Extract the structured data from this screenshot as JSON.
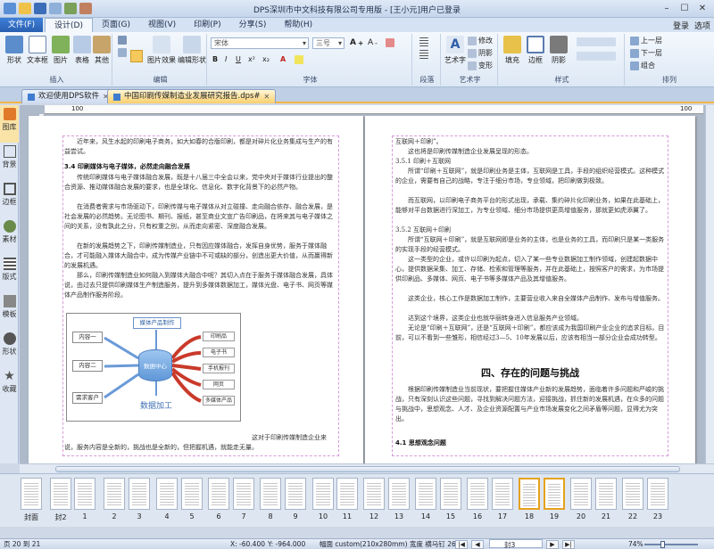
{
  "window": {
    "title": "DPS深圳市中文科技有限公司专用版 - [王小元]用户已登录"
  },
  "menu": {
    "file": "文件(F)",
    "tabs": [
      "设计(D)",
      "页面(G)",
      "视图(V)",
      "印刷(P)",
      "分享(S)",
      "帮助(H)"
    ],
    "right": [
      "登录",
      "选项"
    ]
  },
  "ribbon": {
    "insert": {
      "label": "插入",
      "shape": "形状",
      "textbox": "文本框",
      "image": "图片",
      "table": "表格",
      "other": "其他"
    },
    "edit": {
      "label": "编辑",
      "image_effect": "图片效果",
      "edit_shape": "编辑形状"
    },
    "font": {
      "label": "字体",
      "font_name": "宋体",
      "font_size": "三号"
    },
    "para": {
      "label": "段落"
    },
    "art": {
      "label": "艺术字",
      "arttext": "艺术字",
      "modify": "修改",
      "shadow": "阴影",
      "transform": "变形"
    },
    "style": {
      "label": "样式",
      "fill": "填充",
      "border": "边框",
      "shadow": "阴影"
    },
    "layout": {
      "label": "排列",
      "up": "上一层",
      "down": "下一层",
      "group": "组合"
    }
  },
  "doctabs": [
    "欢迎使用DPS软件",
    "中国印刷传媒制造业发展研究报告.dps#"
  ],
  "sidebar": [
    "图库",
    "背景",
    "边框",
    "素材",
    "版式",
    "模板",
    "形状",
    "收藏"
  ],
  "ruler": {
    "left_mark": "100",
    "right_mark": "100"
  },
  "left_page": {
    "p1": "近年来，风生水起的印刷电子商务，如大如春的合版印刷，都是对碎片化业务集成与生产的有益尝试。",
    "h1": "3.4 印刷媒体与电子媒体，必然走向融合发展",
    "p2": "传统印刷媒体与电子媒体融合发展，既是十八届三中全会以来，党中央对于媒体行业提出的整合资源、推动媒体融合发展的要求，也是全球化、信息化、数字化背景下的必然产物。",
    "p3": "在消费者需求与市场驱动下，印刷传媒与电子媒体从对立碰撞、走向融合依存、融合发展，是社会发展的必然趋势。无论图书、期刊、报纸，甚至商业文宣广告印刷品，在将来其与电子媒体之间的关系，没有孰此之分，只有权重之别，从而走向紧密、深度融合发展。",
    "p4": "在新的发展趋势之下，印刷传媒制造业，只有因应媒体融合，发挥自身优势，服务于媒体融合，才可能融入媒体大融合中，成为传媒产业链中不可或缺的部分，创造出更大价值，从而赢得新的发展机遇。",
    "p5": "那么，印刷传媒制造业如何融入到媒体大融合中呢？其切入点在于服务于媒体融合发展，具体说，由过去只提供印刷媒体生产制造服务，提升到多媒体数据加工，媒体光盘、电子书、网页等媒体产品制作服务阶段。",
    "p6": "这对于印刷传媒制造企业来说，服务内容是全新的，挑战也是全新的，但把握机遇，就能走无量。",
    "diagram": {
      "top": "媒体产品制作",
      "center": "数据中心",
      "bottom": "数据加工",
      "left": [
        "内容一",
        "内容二",
        "需求客户"
      ],
      "right": [
        "印刷品",
        "电子书",
        "手机报刊",
        "网页",
        "多媒体产品"
      ]
    }
  },
  "right_page": {
    "p1": "互联网＋印刷”。",
    "p2": "这也将是印刷传媒制造企业发展呈现的形态。",
    "h1": "3.5.1 印刷＋互联网",
    "p3": "所谓“印刷＋互联网”，就是印刷业务是主体，互联网是工具，手段的组织经营模式。这种模式的企业，需要有自己的战略，专注于细分市场，专业领域，把印刷做到极致。",
    "p4": "而互联网，以印刷电子商务平台的形式出现，承载、集约碎片化印刷业务，如果在此基础上，能够对平台数据进行深加工，为专业领域、细分市场提供更高增值服务，那就更如虎添翼了。",
    "h2": "3.5.2 互联网＋印刷",
    "p5": "所谓“互联网＋印刷”，就是互联网即是业务的主体，也是业务的工具，而印刷只是某一类服务的实现手段的经营模式。",
    "p6": "这一类型的企业，或许以印刷为起点，切入了某一些专业数据加工制作领域，创建起数据中心，提供数据采集、加工、存储、检索和管理等服务，并在此基础上，按照客户的需求，为市场提供印刷品、多媒体、网页、电子书等多媒体产品及其增值服务。",
    "p7": "这类企业，核心工作是数据加工制作，主要营业收入来自全媒体产品制作、发布与增值服务。",
    "p8": "达到这个境界，这类企业也就华丽转身进入信息服务产业领域。",
    "p9": "无论是“印刷＋互联网”，还是“互联网＋印刷”，都应该成为我国印刷产业企业的追求目标。目前，可以不看到一些雏形，相信经过3—5、10年发展以后，应该有相当一部分企业会成功转型。",
    "section": "四、存在的问题与挑战",
    "p10": "根据印刷传媒制造业当前现状，要把握住媒体产业新的发展趋势，面临着许多问题和严峻的挑战，只有深刻认识这些问题，寻找到解决问题方法，迎接挑战，抓住新的发展机遇，在众多的问题与挑战中，思想观念、人才、及企业资源配置与产业市场发展变化之间矛盾等问题，显得尤为突出。",
    "h3": "4.1 思想观念问题"
  },
  "thumbnails": [
    "封面",
    "封2",
    "1",
    "2",
    "3",
    "4",
    "5",
    "6",
    "7",
    "8",
    "9",
    "10",
    "11",
    "12",
    "13",
    "14",
    "15",
    "16",
    "17",
    "18",
    "19",
    "20",
    "21",
    "22",
    "23"
  ],
  "status": {
    "page": "页 20 到 21",
    "x": "X: -60.400",
    "y": "Y: -964.000",
    "size": "幅面 custom(210x280mm) 宽度 横马钉 26页",
    "page_box": "封3",
    "zoom": "74%"
  }
}
